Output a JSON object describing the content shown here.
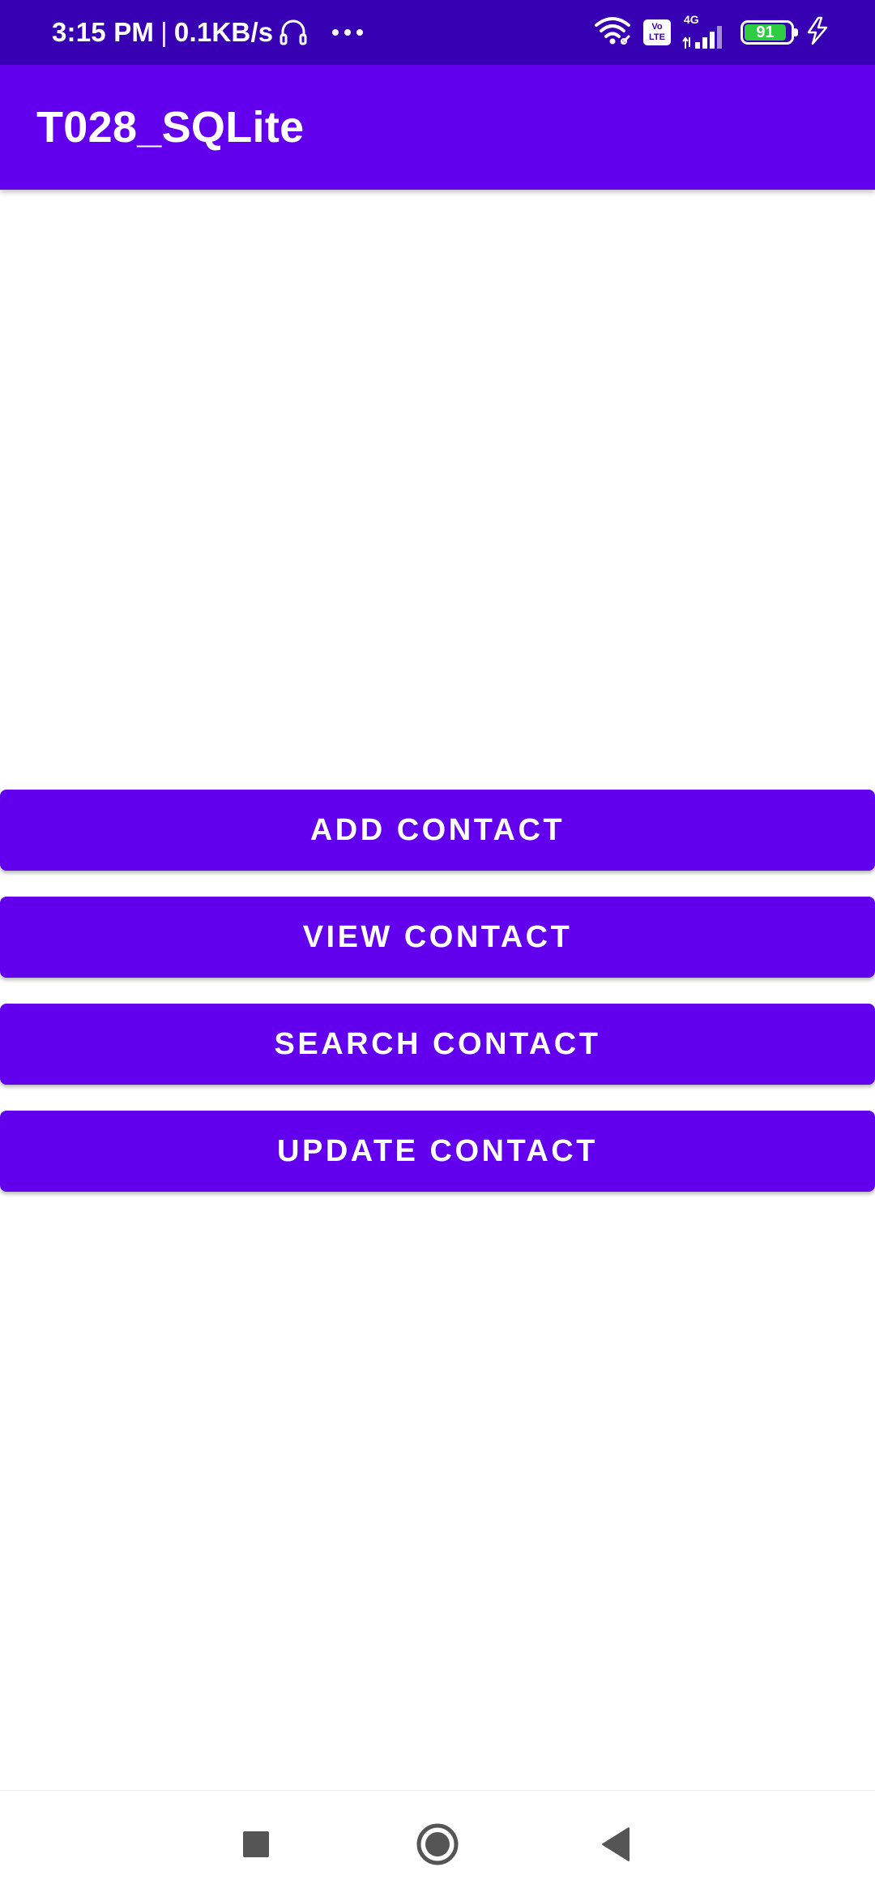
{
  "status_bar": {
    "time": "3:15 PM",
    "separator": "|",
    "data_speed": "0.1KB/s",
    "network_type": "4G",
    "volte_top": "Vo",
    "volte_bottom": "LTE",
    "battery_level": "91",
    "battery_fraction": 0.91,
    "icons": [
      "headset-icon",
      "more-dots-icon",
      "wifi-icon",
      "volte-icon",
      "signal-icon",
      "battery-icon",
      "charging-icon"
    ]
  },
  "app_bar": {
    "title": "T028_SQLite"
  },
  "buttons": [
    {
      "label": "ADD CONTACT"
    },
    {
      "label": "VIEW CONTACT"
    },
    {
      "label": "SEARCH CONTACT"
    },
    {
      "label": "UPDATE CONTACT"
    }
  ],
  "nav_bar": {
    "icons": [
      "recents-square-icon",
      "home-circle-icon",
      "back-triangle-icon"
    ]
  },
  "colors": {
    "primary": "#6200ee",
    "primary_dark": "#3700b3",
    "on_primary": "#ffffff",
    "battery_green": "#2ecc40",
    "nav_icon": "#555555"
  }
}
